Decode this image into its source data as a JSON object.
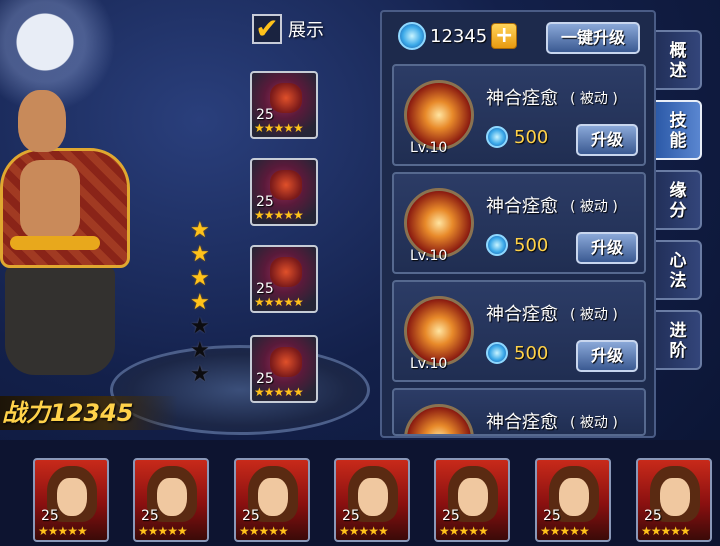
{
  "display_toggle": {
    "label": "展示",
    "checked": true,
    "check_glyph": "✔"
  },
  "equipment": [
    {
      "level": "25",
      "stars": "★★★★★"
    },
    {
      "level": "25",
      "stars": "★★★★★"
    },
    {
      "level": "25",
      "stars": "★★★★★"
    },
    {
      "level": "25",
      "stars": "★★★★★"
    }
  ],
  "rank_stars": {
    "filled": 4,
    "total": 7,
    "glyph": "★"
  },
  "power_label": "战力12345",
  "skills_panel": {
    "currency_value": "12345",
    "plus_label": "+",
    "one_key_upgrade_label": "一键升级",
    "skills": [
      {
        "name": "神合痊愈",
        "type": "( 被动 )",
        "level": "Lv.10",
        "cost": "500",
        "upgrade_label": "升级"
      },
      {
        "name": "神合痊愈",
        "type": "( 被动 )",
        "level": "Lv.10",
        "cost": "500",
        "upgrade_label": "升级"
      },
      {
        "name": "神合痊愈",
        "type": "( 被动 )",
        "level": "Lv.10",
        "cost": "500",
        "upgrade_label": "升级"
      },
      {
        "name": "神合痊愈",
        "type": "( 被动 )",
        "level": "",
        "cost": "",
        "upgrade_label": ""
      }
    ]
  },
  "side_tabs": [
    {
      "label": "概\n述",
      "active": false
    },
    {
      "label": "技\n能",
      "active": true
    },
    {
      "label": "缘\n分",
      "active": false
    },
    {
      "label": "心\n法",
      "active": false
    },
    {
      "label": "进\n阶",
      "active": false
    }
  ],
  "roster": [
    {
      "level": "25",
      "stars": "★★★★★"
    },
    {
      "level": "25",
      "stars": "★★★★★"
    },
    {
      "level": "25",
      "stars": "★★★★★"
    },
    {
      "level": "25",
      "stars": "★★★★★"
    },
    {
      "level": "25",
      "stars": "★★★★★"
    },
    {
      "level": "25",
      "stars": "★★★★★"
    },
    {
      "level": "25",
      "stars": "★★★★★"
    }
  ],
  "colors": {
    "gold": "#ffc21a",
    "panel": "#1d2a4c",
    "accent_blue": "#3b5a92"
  }
}
